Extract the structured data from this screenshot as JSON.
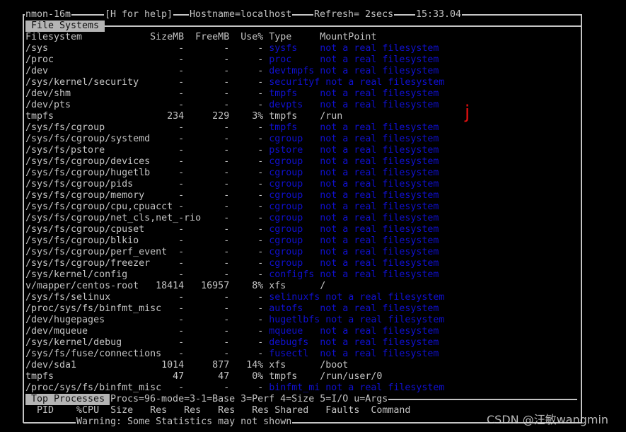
{
  "title_bar": {
    "program": "nmon-16m",
    "help": "[H for help]",
    "hostname": "Hostname=localhost",
    "refresh": "Refresh= 2secs",
    "time": "15:33.04"
  },
  "filesystems": {
    "section_label": "File Systems",
    "header": {
      "filesystem": "Filesystem",
      "size": "SizeMB",
      "free": "FreeMB",
      "use": "Use%",
      "type": "Type",
      "mount": "MountPoint"
    },
    "rows": [
      {
        "name": "/sys",
        "size": "-",
        "free": "-",
        "use": "-",
        "type": "sysfs",
        "mount": "not a real filesystem",
        "real": false
      },
      {
        "name": "/proc",
        "size": "-",
        "free": "-",
        "use": "-",
        "type": "proc",
        "mount": "not a real filesystem",
        "real": false
      },
      {
        "name": "/dev",
        "size": "-",
        "free": "-",
        "use": "-",
        "type": "devtmpfs",
        "mount": "not a real filesystem",
        "real": false
      },
      {
        "name": "/sys/kernel/security",
        "size": "-",
        "free": "-",
        "use": "-",
        "type": "securityf",
        "mount": "not a real filesystem",
        "real": false
      },
      {
        "name": "/dev/shm",
        "size": "-",
        "free": "-",
        "use": "-",
        "type": "tmpfs",
        "mount": "not a real filesystem",
        "real": false
      },
      {
        "name": "/dev/pts",
        "size": "-",
        "free": "-",
        "use": "-",
        "type": "devpts",
        "mount": "not a real filesystem",
        "real": false
      },
      {
        "name": "tmpfs",
        "size": "234",
        "free": "229",
        "use": "3%",
        "type": "tmpfs",
        "mount": "/run",
        "real": true
      },
      {
        "name": "/sys/fs/cgroup",
        "size": "-",
        "free": "-",
        "use": "-",
        "type": "tmpfs",
        "mount": "not a real filesystem",
        "real": false
      },
      {
        "name": "/sys/fs/cgroup/systemd",
        "size": "-",
        "free": "-",
        "use": "-",
        "type": "cgroup",
        "mount": "not a real filesystem",
        "real": false
      },
      {
        "name": "/sys/fs/pstore",
        "size": "-",
        "free": "-",
        "use": "-",
        "type": "pstore",
        "mount": "not a real filesystem",
        "real": false
      },
      {
        "name": "/sys/fs/cgroup/devices",
        "size": "-",
        "free": "-",
        "use": "-",
        "type": "cgroup",
        "mount": "not a real filesystem",
        "real": false
      },
      {
        "name": "/sys/fs/cgroup/hugetlb",
        "size": "-",
        "free": "-",
        "use": "-",
        "type": "cgroup",
        "mount": "not a real filesystem",
        "real": false
      },
      {
        "name": "/sys/fs/cgroup/pids",
        "size": "-",
        "free": "-",
        "use": "-",
        "type": "cgroup",
        "mount": "not a real filesystem",
        "real": false
      },
      {
        "name": "/sys/fs/cgroup/memory",
        "size": "-",
        "free": "-",
        "use": "-",
        "type": "cgroup",
        "mount": "not a real filesystem",
        "real": false
      },
      {
        "name": "/sys/fs/cgroup/cpu,cpuacct",
        "size": "-",
        "free": "-",
        "use": "-",
        "type": "cgroup",
        "mount": "not a real filesystem",
        "real": false
      },
      {
        "name": "/sys/fs/cgroup/net_cls,net_-rio",
        "size": "-",
        "free": "-",
        "use": "-",
        "type": "cgroup",
        "mount": "not a real filesystem",
        "real": false
      },
      {
        "name": "/sys/fs/cgroup/cpuset",
        "size": "-",
        "free": "-",
        "use": "-",
        "type": "cgroup",
        "mount": "not a real filesystem",
        "real": false
      },
      {
        "name": "/sys/fs/cgroup/blkio",
        "size": "-",
        "free": "-",
        "use": "-",
        "type": "cgroup",
        "mount": "not a real filesystem",
        "real": false
      },
      {
        "name": "/sys/fs/cgroup/perf_event",
        "size": "-",
        "free": "-",
        "use": "-",
        "type": "cgroup",
        "mount": "not a real filesystem",
        "real": false
      },
      {
        "name": "/sys/fs/cgroup/freezer",
        "size": "-",
        "free": "-",
        "use": "-",
        "type": "cgroup",
        "mount": "not a real filesystem",
        "real": false
      },
      {
        "name": "/sys/kernel/config",
        "size": "-",
        "free": "-",
        "use": "-",
        "type": "configfs",
        "mount": "not a real filesystem",
        "real": false
      },
      {
        "name": "v/mapper/centos-root",
        "size": "18414",
        "free": "16957",
        "use": "8%",
        "type": "xfs",
        "mount": "/",
        "real": true
      },
      {
        "name": "/sys/fs/selinux",
        "size": "-",
        "free": "-",
        "use": "-",
        "type": "selinuxfs",
        "mount": "not a real filesystem",
        "real": false
      },
      {
        "name": "/proc/sys/fs/binfmt_misc",
        "size": "-",
        "free": "-",
        "use": "-",
        "type": "autofs",
        "mount": "not a real filesystem",
        "real": false
      },
      {
        "name": "/dev/hugepages",
        "size": "-",
        "free": "-",
        "use": "-",
        "type": "hugetlbfs",
        "mount": "not a real filesystem",
        "real": false
      },
      {
        "name": "/dev/mqueue",
        "size": "-",
        "free": "-",
        "use": "-",
        "type": "mqueue",
        "mount": "not a real filesystem",
        "real": false
      },
      {
        "name": "/sys/kernel/debug",
        "size": "-",
        "free": "-",
        "use": "-",
        "type": "debugfs",
        "mount": "not a real filesystem",
        "real": false
      },
      {
        "name": "/sys/fs/fuse/connections",
        "size": "-",
        "free": "-",
        "use": "-",
        "type": "fusectl",
        "mount": "not a real filesystem",
        "real": false
      },
      {
        "name": "/dev/sda1",
        "size": "1014",
        "free": "877",
        "use": "14%",
        "type": "xfs",
        "mount": "/boot",
        "real": true
      },
      {
        "name": "tmpfs",
        "size": "47",
        "free": "47",
        "use": "0%",
        "type": "tmpfs",
        "mount": "/run/user/0",
        "real": true
      },
      {
        "name": "/proc/sys/fs/binfmt_misc",
        "size": "-",
        "free": "-",
        "use": "-",
        "type": "binfmt_mi",
        "mount": "not a real filesystem",
        "real": false
      }
    ]
  },
  "top_processes": {
    "section_label": "Top Processes",
    "modes": "Procs=96-mode=3-1=Base 3=Perf 4=Size 5=I/O u=Args",
    "columns": [
      "PID",
      "%CPU",
      "Size",
      "Res",
      "Res",
      "Res",
      "Res",
      "Shared",
      "Faults",
      "Command"
    ],
    "warning": "Warning: Some Statistics may not shown"
  },
  "annotation": "j",
  "watermark": "CSDN @汪敏wangmin",
  "colors": {
    "text": "#c4c4c4",
    "virtual_fs": "#1010d0",
    "label_bg": "#b4b4b4",
    "background": "#000000",
    "annotation": "#e01010"
  }
}
